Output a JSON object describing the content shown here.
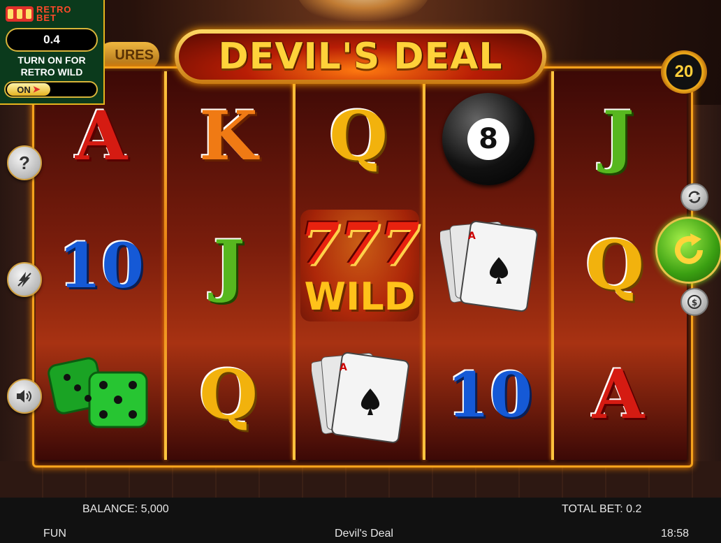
{
  "game": {
    "title": "DEVIL'S DEAL",
    "features_tab": "URES",
    "lines": "20"
  },
  "retro_bet": {
    "brand": "RETRO BET",
    "value": "0.4",
    "message": "TURN ON FOR RETRO WILD",
    "toggle_label": "ON"
  },
  "reels": [
    [
      "A",
      "10",
      "dice"
    ],
    [
      "K",
      "J",
      "Q"
    ],
    [
      "Q",
      "WILD",
      "cards"
    ],
    [
      "8",
      "cards",
      "10"
    ],
    [
      "J",
      "Q",
      "A"
    ]
  ],
  "symbols": {
    "wild_label": "WILD",
    "wild_number": "777",
    "ball_number": "8"
  },
  "side_buttons": {
    "help_label": "?",
    "turbo_icon": "lightning-icon",
    "sound_icon": "speaker-icon",
    "autoplay_icon": "repeat-icon",
    "spin_icon": "spin-arrow-icon",
    "bet_icon": "coin-icon"
  },
  "footer": {
    "balance": "BALANCE: 5,000",
    "total_bet": "TOTAL BET: 0.2",
    "mode": "FUN",
    "game_name": "Devil's Deal",
    "time": "18:58"
  },
  "colors": {
    "frame": "#f5a21c",
    "reel_bg": "#7a1d0c",
    "retro_panel": "#0b3a1c",
    "spin_button": "#3a9f12"
  }
}
